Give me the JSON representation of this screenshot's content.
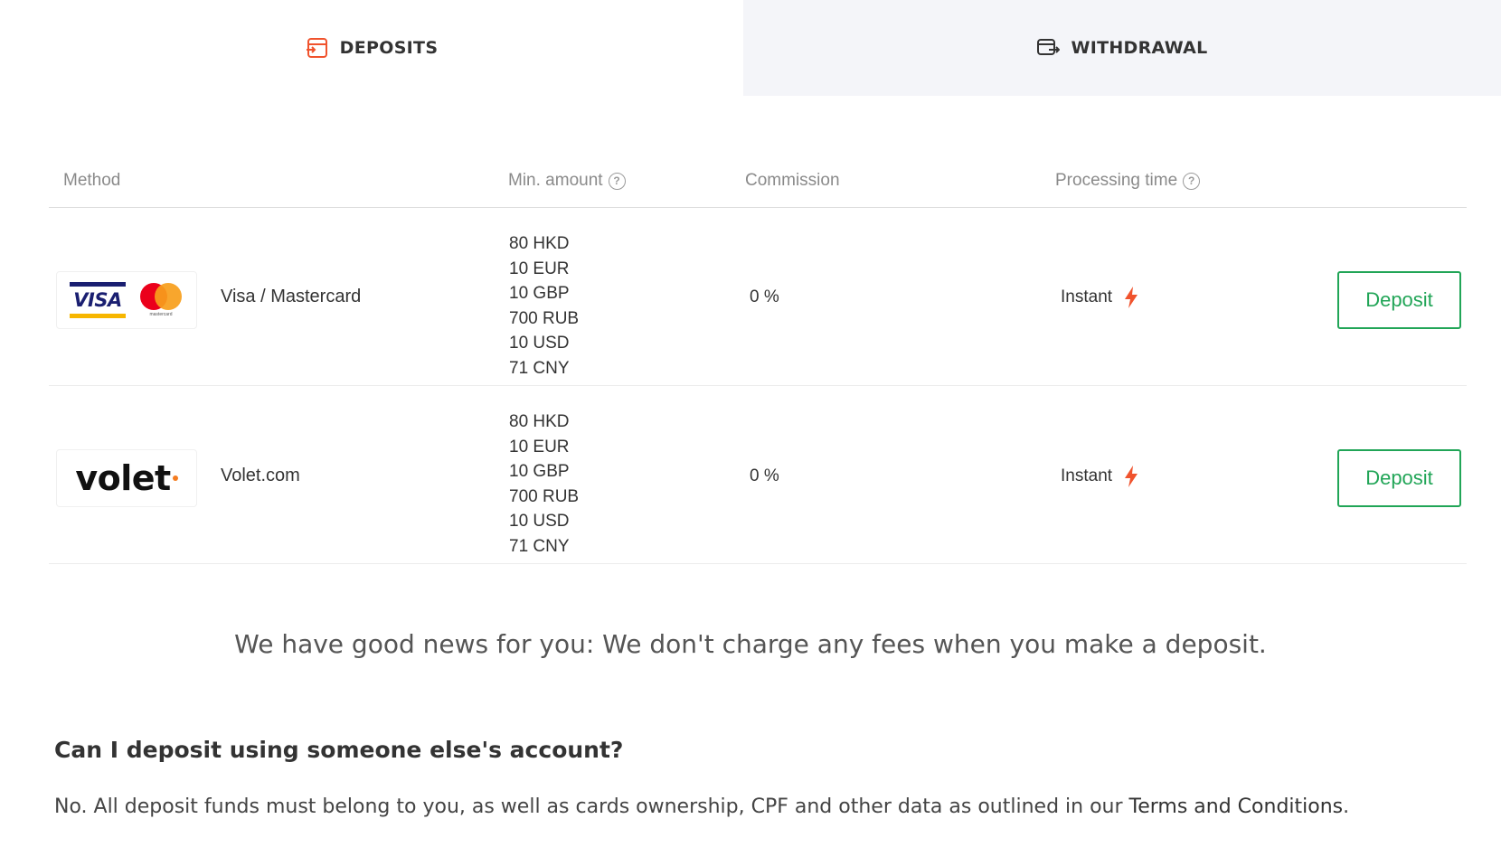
{
  "tabs": [
    {
      "label": "DEPOSITS",
      "icon": "deposit-card-icon",
      "active": true
    },
    {
      "label": "WITHDRAWAL",
      "icon": "withdrawal-card-icon",
      "active": false
    }
  ],
  "table": {
    "headers": {
      "method": "Method",
      "min_amount": "Min. amount",
      "commission": "Commission",
      "processing_time": "Processing time"
    },
    "rows": [
      {
        "logo": "visa-mastercard-logo",
        "logo_visa_text": "VISA",
        "logo_mc_text": "mastercard",
        "method": "Visa / Mastercard",
        "min_amounts": [
          "80 HKD",
          "10 EUR",
          "10 GBP",
          "700 RUB",
          "10 USD",
          "71 CNY"
        ],
        "commission": "0 %",
        "processing": "Instant",
        "button": "Deposit"
      },
      {
        "logo": "volet-logo",
        "logo_text": "volet",
        "method": "Volet.com",
        "min_amounts": [
          "80 HKD",
          "10 EUR",
          "10 GBP",
          "700 RUB",
          "10 USD",
          "71 CNY"
        ],
        "commission": "0 %",
        "processing": "Instant",
        "button": "Deposit"
      }
    ]
  },
  "good_news": "We have good news for you: We don't charge any fees when you make a deposit.",
  "faq": {
    "question": "Can I deposit using someone else's account?",
    "answer_prefix": "No. All deposit funds must belong to you, as well as cards ownership, CPF and other data as outlined in our ",
    "answer_link": "Terms and Conditions",
    "answer_suffix": "."
  },
  "colors": {
    "accent_orange": "#f0532d",
    "deposit_green": "#21a557",
    "withdraw_tab_bg": "#f4f5f9"
  }
}
